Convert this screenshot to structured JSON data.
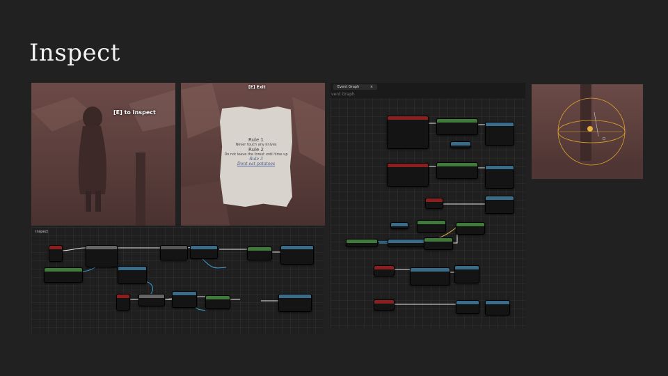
{
  "slide": {
    "title": "Inspect"
  },
  "screens": {
    "inspect_prompt": "[E] to Inspect",
    "exit_prompt": "[E] Exit",
    "note": {
      "rule1_title": "Rule 1",
      "rule1_text": "Never touch any knives",
      "rule2_title": "Rule 2",
      "rule2_text": "Do not leave the forest until time up",
      "rule3_title": "Rule 3",
      "rule3_text": "Dont eat potatoes"
    }
  },
  "inspect_graph": {
    "label": "Inspect"
  },
  "event_graph": {
    "tab_label": "Event Graph",
    "tab_close": "×",
    "subtitle": "vent Graph"
  },
  "colors": {
    "background": "#212121",
    "scene": "#6b4a47",
    "event_node": "#8b1e1e",
    "function_node": "#3a6c8a",
    "branch_node": "#444444",
    "variable_node": "#3f7a3a",
    "exec_wire": "#e8e8e8",
    "data_wire": "#3fa0d8"
  }
}
